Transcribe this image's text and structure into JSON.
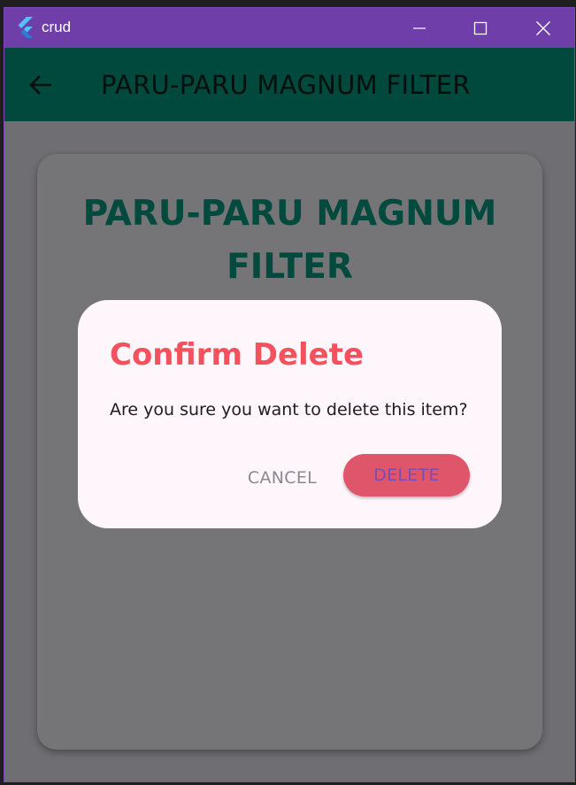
{
  "window": {
    "title": "crud"
  },
  "appbar": {
    "title": "PARU-PARU MAGNUM FILTER"
  },
  "card": {
    "title": "PARU-PARU MAGNUM FILTER"
  },
  "dialog": {
    "title": "Confirm Delete",
    "message": "Are you sure you want to delete this item?",
    "cancel_label": "CANCEL",
    "delete_label": "DELETE"
  },
  "icons": {
    "app": "flutter-logo-icon",
    "minimize": "minimize-icon",
    "maximize": "maximize-icon",
    "close": "close-icon",
    "back": "arrow-left-icon"
  },
  "colors": {
    "titlebar": "#6f3ea8",
    "appbar": "#02493d",
    "card_title": "#024a3d",
    "dialog_title": "#f2515d",
    "delete_button": "#df566b",
    "delete_text": "#7b4bb8",
    "scrim": "#6f6e72"
  }
}
